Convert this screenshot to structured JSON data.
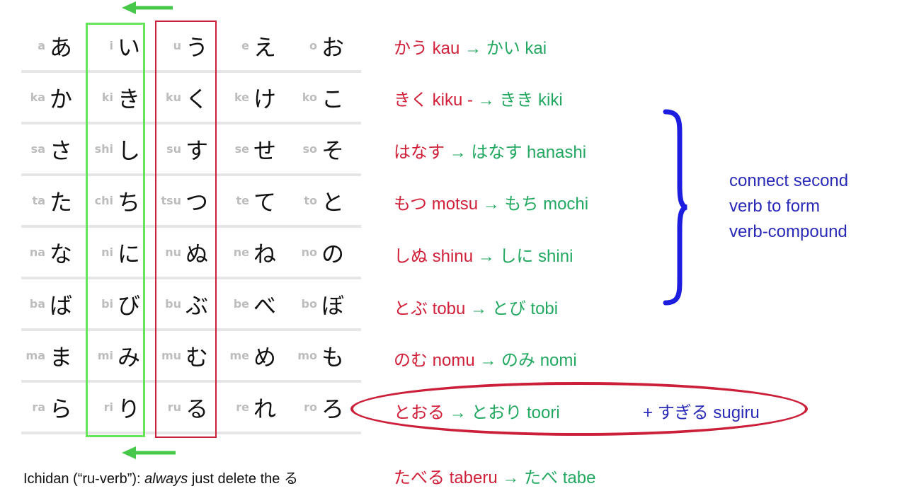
{
  "table": {
    "rows": [
      [
        [
          "a",
          "あ"
        ],
        [
          "i",
          "い"
        ],
        [
          "u",
          "う"
        ],
        [
          "e",
          "え"
        ],
        [
          "o",
          "お"
        ]
      ],
      [
        [
          "ka",
          "か"
        ],
        [
          "ki",
          "き"
        ],
        [
          "ku",
          "く"
        ],
        [
          "ke",
          "け"
        ],
        [
          "ko",
          "こ"
        ]
      ],
      [
        [
          "sa",
          "さ"
        ],
        [
          "shi",
          "し"
        ],
        [
          "su",
          "す"
        ],
        [
          "se",
          "せ"
        ],
        [
          "so",
          "そ"
        ]
      ],
      [
        [
          "ta",
          "た"
        ],
        [
          "chi",
          "ち"
        ],
        [
          "tsu",
          "つ"
        ],
        [
          "te",
          "て"
        ],
        [
          "to",
          "と"
        ]
      ],
      [
        [
          "na",
          "な"
        ],
        [
          "ni",
          "に"
        ],
        [
          "nu",
          "ぬ"
        ],
        [
          "ne",
          "ね"
        ],
        [
          "no",
          "の"
        ]
      ],
      [
        [
          "ba",
          "ば"
        ],
        [
          "bi",
          "び"
        ],
        [
          "bu",
          "ぶ"
        ],
        [
          "be",
          "べ"
        ],
        [
          "bo",
          "ぼ"
        ]
      ],
      [
        [
          "ma",
          "ま"
        ],
        [
          "mi",
          "み"
        ],
        [
          "mu",
          "む"
        ],
        [
          "me",
          "め"
        ],
        [
          "mo",
          "も"
        ]
      ],
      [
        [
          "ra",
          "ら"
        ],
        [
          "ri",
          "り"
        ],
        [
          "ru",
          "る"
        ],
        [
          "re",
          "れ"
        ],
        [
          "ro",
          "ろ"
        ]
      ]
    ]
  },
  "conjugations": [
    {
      "src": "かう kau",
      "arrow": " → ",
      "dst": "かい kai"
    },
    {
      "src": "きく kiku -",
      "arrow": " → ",
      "dst": "きき  kiki"
    },
    {
      "src": "はなす",
      "arrow": " → ",
      "dst": "はなす hanashi"
    },
    {
      "src": "もつ  motsu",
      "arrow": " → ",
      "dst": "もち mochi"
    },
    {
      "src": "しぬ shinu",
      "arrow": " → ",
      "dst": "しに shini"
    },
    {
      "src": "とぶ tobu",
      "arrow": " → ",
      "dst": "とび  tobi"
    },
    {
      "src": "のむ nomu",
      "arrow": " → ",
      "dst": "のみ  nomi"
    },
    {
      "src": "とおる",
      "arrow": " → ",
      "dst": "とおり toori"
    },
    {
      "src": "たべる taberu",
      "arrow": " → ",
      "dst": "たべ tabe"
    }
  ],
  "note": {
    "line1": "connect second",
    "line2": "verb to form",
    "line3": "verb-compound"
  },
  "sugiru": "+ すぎる sugiru",
  "caption": {
    "part1": "Ichidan (“ru-verb”): ",
    "emph": "always",
    "part2": " just delete the る"
  },
  "colors": {
    "verb_source": "#d0203a",
    "verb_result": "#22a860",
    "note": "#2a2ab8",
    "i_column_box": "#66e45a",
    "u_column_box": "#cc1f3a"
  }
}
